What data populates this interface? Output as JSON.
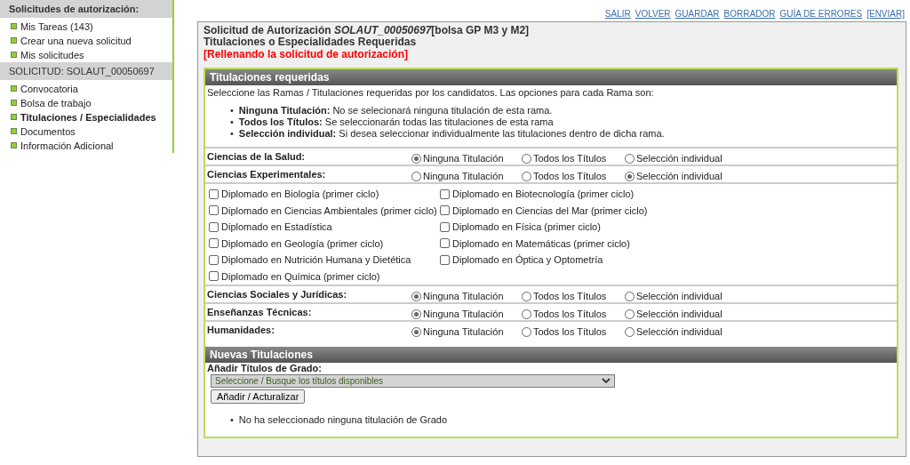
{
  "sidebar": {
    "sections": [
      {
        "title": "Solicitudes de autorización:",
        "items": [
          {
            "label": "Mis Tareas (143)",
            "selected": false
          },
          {
            "label": "Crear una nueva solicitud",
            "selected": false
          },
          {
            "label": "Mis solicitudes",
            "selected": false
          }
        ]
      },
      {
        "title": "SOLICITUD: SOLAUT_00050697",
        "items": [
          {
            "label": "Convocatoria",
            "selected": false
          },
          {
            "label": "Bolsa de trabajo",
            "selected": false
          },
          {
            "label": "Titulaciones / Especialidades",
            "selected": true
          },
          {
            "label": "Documentos",
            "selected": false
          },
          {
            "label": "Información Adicional",
            "selected": false
          }
        ]
      }
    ]
  },
  "top_links": [
    "SALIR",
    "VOLVER",
    "GUARDAR",
    "BORRADOR",
    "GUÍA DE ERRORES",
    "[ENVIAR]"
  ],
  "header": {
    "title": "Solicitud de Autorización *SOLAUT_00050697*[bolsa GP M3 y M2]",
    "subtitle": "Titulaciones o Especialidades Requeridas",
    "status": "[Rellenando la solicitud de autorización]"
  },
  "required_section": {
    "title": "Titulaciones requeridas",
    "intro": "Seleccione las Ramas / Titulaciones requeridas por los candidatos. Las opciones para cada Rama son:",
    "legend": [
      {
        "marker": "•",
        "text": "**Ninguna Titulación:** No se selecionará ninguna titulación de esta rama."
      },
      {
        "marker": "•",
        "text": "**Todos los Títulos:** Se seleccionarán todas las titulaciones de esta rama"
      },
      {
        "marker": "•",
        "text": "**Selección individual:** Si desea seleccionar individualmente las titulaciones dentro de dicha rama."
      }
    ],
    "branches": [
      {
        "name": "Ciencias de la Salud:",
        "options": [
          {
            "label": "Ninguna Titulación",
            "selected": true
          },
          {
            "label": "Todos los Títulos",
            "selected": false
          },
          {
            "label": "Selección individual",
            "selected": false
          }
        ]
      },
      {
        "name": "Ciencias Experimentales:",
        "options": [
          {
            "label": "Ninguna Titulación",
            "selected": false
          },
          {
            "label": "Todos los Títulos",
            "selected": false
          },
          {
            "label": "Selección individual",
            "selected": true
          }
        ],
        "degrees": [
          {
            "label": "Diplomado en Biología (primer ciclo)",
            "checked": false
          },
          {
            "label": "Diplomado en Biotecnología (primer ciclo)",
            "checked": false
          },
          {
            "label": "Diplomado en Ciencias Ambientales (primer ciclo)",
            "checked": false
          },
          {
            "label": "Diplomado en Ciencias del Mar (primer ciclo)",
            "checked": false
          },
          {
            "label": "Diplomado en Estadística",
            "checked": false
          },
          {
            "label": "Diplomado en Física (primer ciclo)",
            "checked": false
          },
          {
            "label": "Diplomado en Geología (primer ciclo)",
            "checked": false
          },
          {
            "label": "Diplomado en Matemáticas (primer ciclo)",
            "checked": false
          },
          {
            "label": "Diplomado en Nutrición Humana y Dietética",
            "checked": false
          },
          {
            "label": "Diplomado en Óptica y Optometría",
            "checked": false
          },
          {
            "label": "Diplomado en Química (primer ciclo)",
            "checked": false
          }
        ]
      },
      {
        "name": "Ciencias Sociales y Jurídicas:",
        "options": [
          {
            "label": "Ninguna Titulación",
            "selected": true
          },
          {
            "label": "Todos los Títulos",
            "selected": false
          },
          {
            "label": "Selección individual",
            "selected": false
          }
        ]
      },
      {
        "name": "Enseñanzas Técnicas:",
        "options": [
          {
            "label": "Ninguna Titulación",
            "selected": true
          },
          {
            "label": "Todos los Títulos",
            "selected": false
          },
          {
            "label": "Selección individual",
            "selected": false
          }
        ]
      },
      {
        "name": "Humanidades:",
        "options": [
          {
            "label": "Ninguna Titulación",
            "selected": true
          },
          {
            "label": "Todos los Títulos",
            "selected": false
          },
          {
            "label": "Selección individual",
            "selected": false
          }
        ]
      }
    ]
  },
  "new_section": {
    "title": "Nuevas Titulaciones",
    "label": "Añadir Títulos de Grado:",
    "select_value": "Seleccione / Busque los títulos disponibles",
    "button": "Añadir / Acturalizar",
    "note_marker": "•",
    "note": "No ha seleccionado ninguna titulación de Grado"
  }
}
